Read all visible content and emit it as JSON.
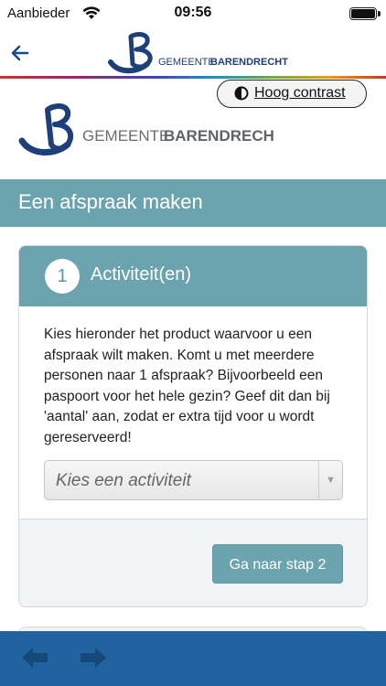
{
  "status_bar": {
    "carrier": "Aanbieder",
    "time": "09:56"
  },
  "header": {
    "logo_text_part1": "GEMEENTE",
    "logo_text_part2": "BARENDRECHT"
  },
  "contrast_button": {
    "label": "Hoog contrast"
  },
  "page": {
    "title": "Een afspraak maken"
  },
  "step": {
    "number": "1",
    "title": "Activiteit(en)",
    "intro": "Kies hieronder het product waarvoor u een afspraak wilt maken. Komt u met meerdere personen naar 1 afspraak? Bijvoorbeeld een paspoort voor het hele gezin? Geef dit dan bij 'aantal' aan, zodat er extra tijd voor u wordt gereserveerd!",
    "select_value": "Kies een activiteit",
    "next_label": "Ga naar stap 2"
  },
  "colors": {
    "accent": "#6ba3ae",
    "bottom_bar": "#2162a0",
    "logo_blue": "#1f3f7a"
  },
  "icons": {
    "back": "arrow-left-icon",
    "contrast": "half-circle-contrast-icon",
    "nav_back": "arrow-left-icon",
    "nav_forward": "arrow-right-icon"
  }
}
